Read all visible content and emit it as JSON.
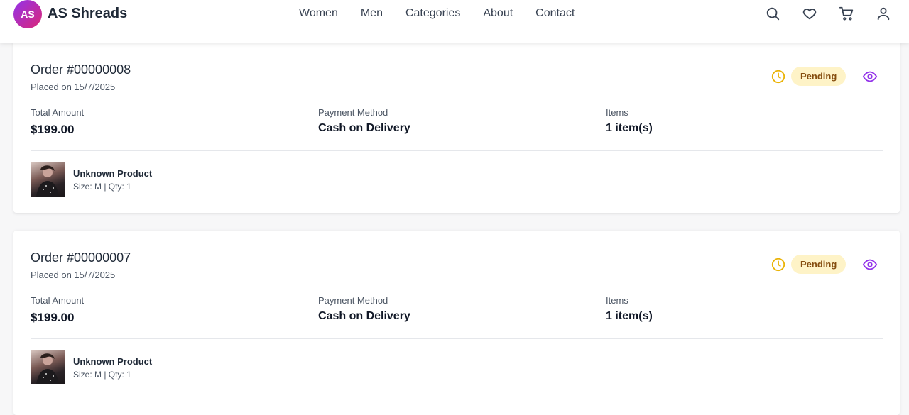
{
  "brand": {
    "initials": "AS",
    "name": "AS Shreads"
  },
  "nav": {
    "links": [
      "Women",
      "Men",
      "Categories",
      "About",
      "Contact"
    ],
    "icons": [
      "search-icon",
      "heart-icon",
      "cart-icon",
      "user-icon"
    ]
  },
  "labels": {
    "total_amount": "Total Amount",
    "payment_method": "Payment Method",
    "items": "Items"
  },
  "colors": {
    "brand_gradient_start": "#9333ea",
    "brand_gradient_end": "#db2777",
    "status_pending_bg": "#fef3c7",
    "status_pending_text": "#854d0e",
    "clock_icon": "#eab308",
    "eye_icon": "#9333ea"
  },
  "orders": [
    {
      "title": "Order #00000008",
      "placed": "Placed on 15/7/2025",
      "status": "Pending",
      "total": "$199.00",
      "payment": "Cash on Delivery",
      "items_count": "1 item(s)",
      "product": {
        "name": "Unknown Product",
        "meta": "Size: M | Qty: 1"
      }
    },
    {
      "title": "Order #00000007",
      "placed": "Placed on 15/7/2025",
      "status": "Pending",
      "total": "$199.00",
      "payment": "Cash on Delivery",
      "items_count": "1 item(s)",
      "product": {
        "name": "Unknown Product",
        "meta": "Size: M | Qty: 1"
      }
    }
  ]
}
